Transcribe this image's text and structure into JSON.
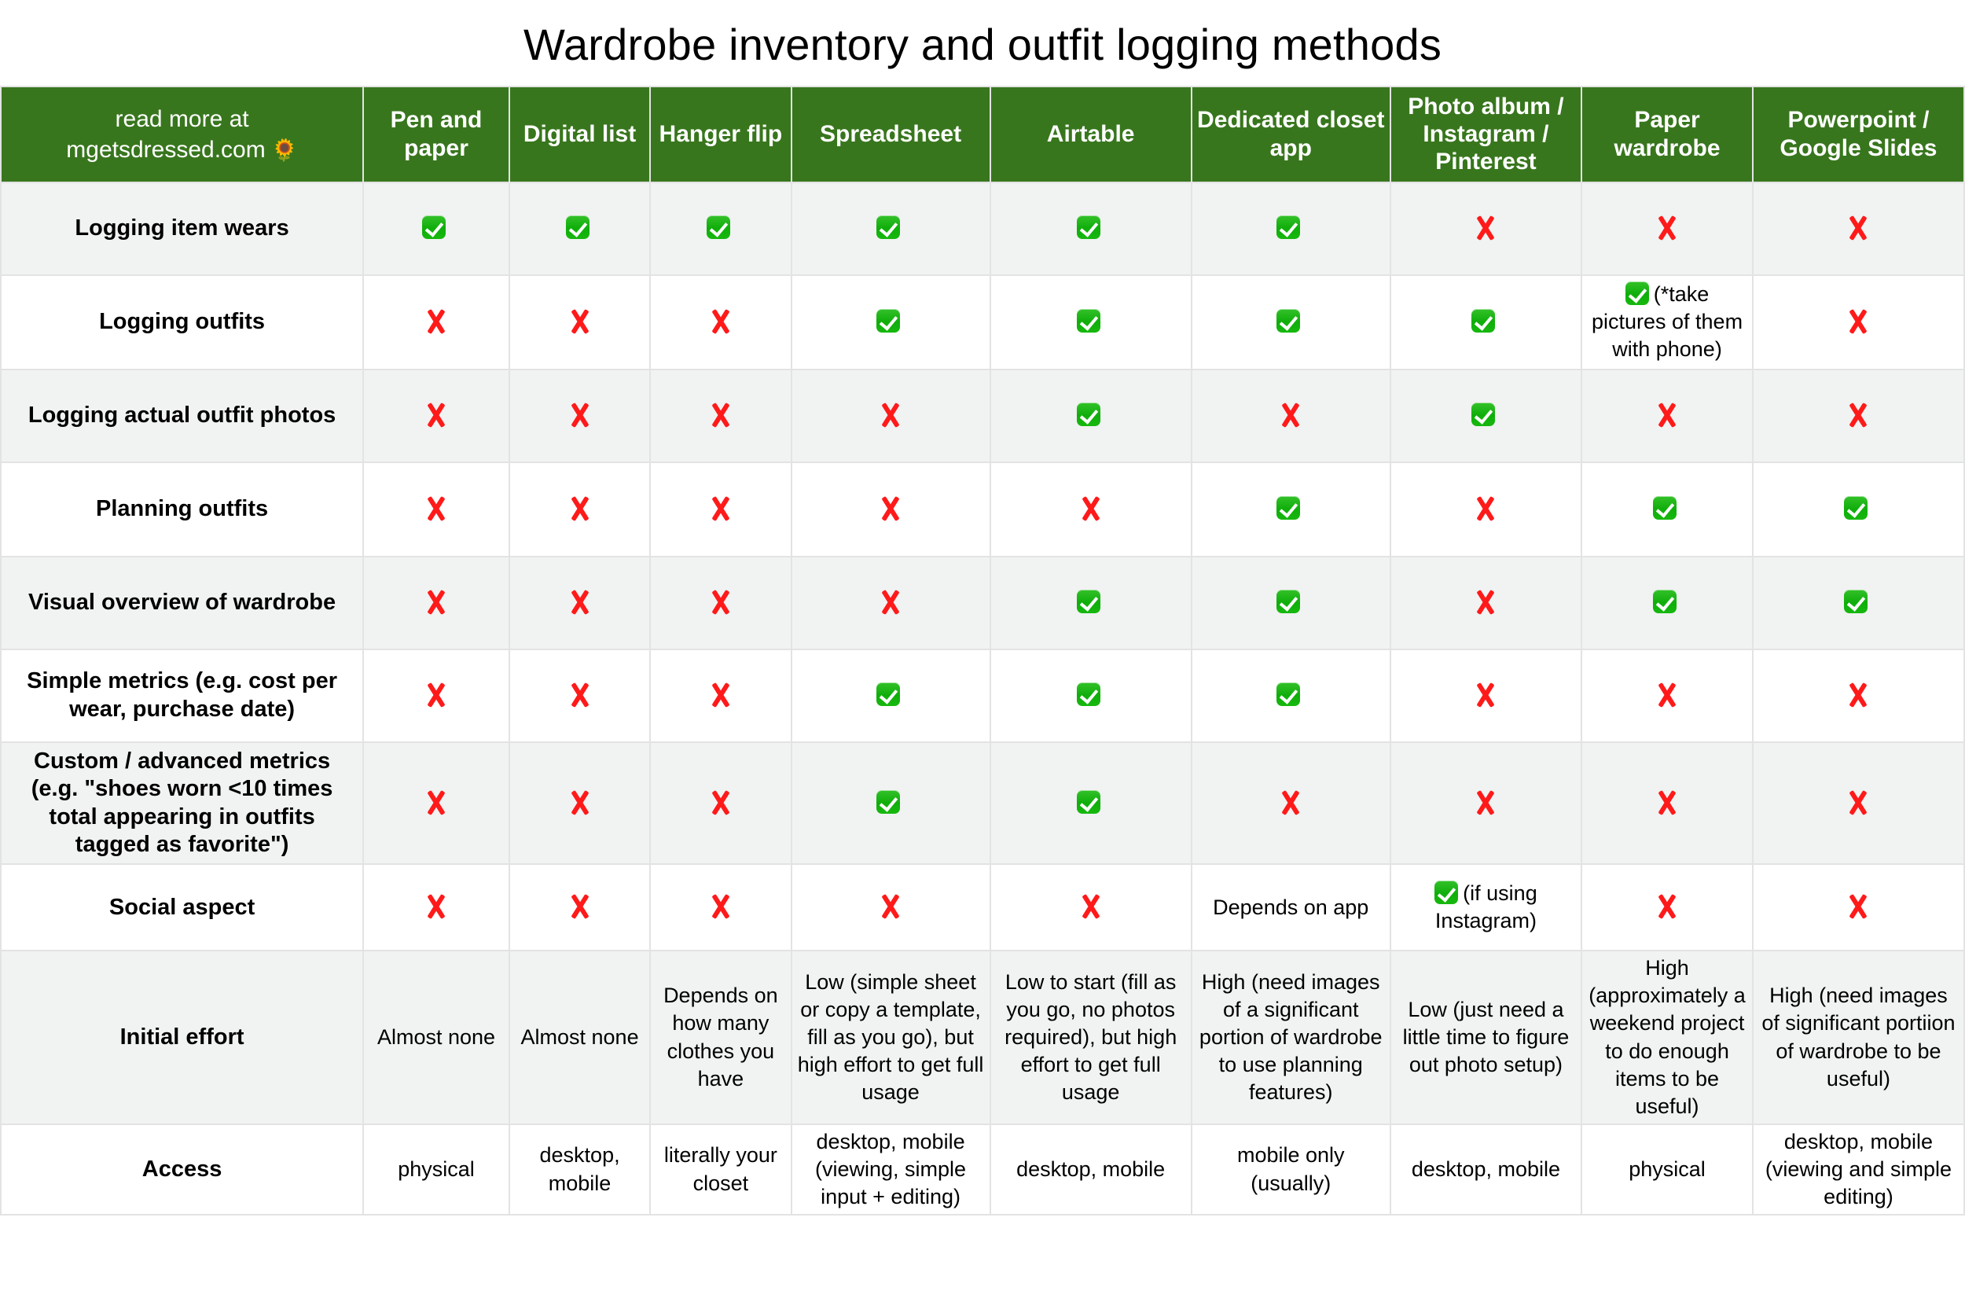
{
  "title": "Wardrobe inventory and outfit logging methods",
  "header": {
    "corner_line1": "read more at",
    "corner_line2": "mgetsdressed.com",
    "corner_icon": "sunflower-icon",
    "columns": [
      "Pen and paper",
      "Digital list",
      "Hanger flip",
      "Spreadsheet",
      "Airtable",
      "Dedicated closet app",
      "Photo album / Instagram / Pinterest",
      "Paper wardrobe",
      "Powerpoint / Google Slides"
    ]
  },
  "colors": {
    "header_green": "#38761d",
    "check_green": "#12b00c",
    "x_red": "#ff1a1a",
    "alt_row": "#f1f2f2"
  },
  "rows": [
    {
      "label": "Logging item wears",
      "cells": [
        {
          "mark": "check"
        },
        {
          "mark": "check"
        },
        {
          "mark": "check"
        },
        {
          "mark": "check"
        },
        {
          "mark": "check"
        },
        {
          "mark": "check"
        },
        {
          "mark": "x"
        },
        {
          "mark": "x"
        },
        {
          "mark": "x"
        }
      ]
    },
    {
      "label": "Logging outfits",
      "cells": [
        {
          "mark": "x"
        },
        {
          "mark": "x"
        },
        {
          "mark": "x"
        },
        {
          "mark": "check"
        },
        {
          "mark": "check"
        },
        {
          "mark": "check"
        },
        {
          "mark": "check"
        },
        {
          "mark": "check",
          "text": "(*take pictures of them with phone)"
        },
        {
          "mark": "x"
        }
      ]
    },
    {
      "label": "Logging actual outfit photos",
      "cells": [
        {
          "mark": "x"
        },
        {
          "mark": "x"
        },
        {
          "mark": "x"
        },
        {
          "mark": "x"
        },
        {
          "mark": "check"
        },
        {
          "mark": "x"
        },
        {
          "mark": "check"
        },
        {
          "mark": "x"
        },
        {
          "mark": "x"
        }
      ]
    },
    {
      "label": "Planning outfits",
      "cells": [
        {
          "mark": "x"
        },
        {
          "mark": "x"
        },
        {
          "mark": "x"
        },
        {
          "mark": "x"
        },
        {
          "mark": "x"
        },
        {
          "mark": "check"
        },
        {
          "mark": "x"
        },
        {
          "mark": "check"
        },
        {
          "mark": "check"
        }
      ]
    },
    {
      "label": "Visual overview of wardrobe",
      "cells": [
        {
          "mark": "x"
        },
        {
          "mark": "x"
        },
        {
          "mark": "x"
        },
        {
          "mark": "x"
        },
        {
          "mark": "check"
        },
        {
          "mark": "check"
        },
        {
          "mark": "x"
        },
        {
          "mark": "check"
        },
        {
          "mark": "check"
        }
      ]
    },
    {
      "label": "Simple metrics (e.g. cost per wear, purchase date)",
      "cells": [
        {
          "mark": "x"
        },
        {
          "mark": "x"
        },
        {
          "mark": "x"
        },
        {
          "mark": "check"
        },
        {
          "mark": "check"
        },
        {
          "mark": "check"
        },
        {
          "mark": "x"
        },
        {
          "mark": "x"
        },
        {
          "mark": "x"
        }
      ]
    },
    {
      "label": "Custom / advanced metrics (e.g. \"shoes worn <10 times total appearing in outfits tagged as favorite\")",
      "cells": [
        {
          "mark": "x"
        },
        {
          "mark": "x"
        },
        {
          "mark": "x"
        },
        {
          "mark": "check"
        },
        {
          "mark": "check"
        },
        {
          "mark": "x"
        },
        {
          "mark": "x"
        },
        {
          "mark": "x"
        },
        {
          "mark": "x"
        }
      ]
    },
    {
      "label": "Social aspect",
      "cells": [
        {
          "mark": "x"
        },
        {
          "mark": "x"
        },
        {
          "mark": "x"
        },
        {
          "mark": "x"
        },
        {
          "mark": "x"
        },
        {
          "mark": "none",
          "text": "Depends on app"
        },
        {
          "mark": "check",
          "text": "(if using Instagram)"
        },
        {
          "mark": "x"
        },
        {
          "mark": "x"
        }
      ]
    },
    {
      "label": "Initial effort",
      "style": "effort",
      "cells": [
        {
          "mark": "none",
          "text": "Almost none"
        },
        {
          "mark": "none",
          "text": "Almost none"
        },
        {
          "mark": "none",
          "text": "Depends on how many clothes you have"
        },
        {
          "mark": "none",
          "text": "Low (simple sheet or copy a template, fill as you go), but high effort to get full usage"
        },
        {
          "mark": "none",
          "text": "Low to start (fill as you go, no photos required), but high effort to get full usage"
        },
        {
          "mark": "none",
          "text": "High (need images of a significant portion of wardrobe to use planning features)"
        },
        {
          "mark": "none",
          "text": "Low (just need a little time to figure out photo setup)"
        },
        {
          "mark": "none",
          "text": "High (approximately a weekend project to do enough items to be useful)"
        },
        {
          "mark": "none",
          "text": "High (need images of significant portiion of wardrobe to be useful)"
        }
      ]
    },
    {
      "label": "Access",
      "style": "access",
      "cells": [
        {
          "mark": "none",
          "text": "physical"
        },
        {
          "mark": "none",
          "text": "desktop, mobile"
        },
        {
          "mark": "none",
          "text": "literally your closet"
        },
        {
          "mark": "none",
          "text": "desktop, mobile (viewing, simple input + editing)"
        },
        {
          "mark": "none",
          "text": "desktop, mobile"
        },
        {
          "mark": "none",
          "text": "mobile only (usually)"
        },
        {
          "mark": "none",
          "text": "desktop, mobile"
        },
        {
          "mark": "none",
          "text": "physical"
        },
        {
          "mark": "none",
          "text": "desktop, mobile (viewing and simple editing)"
        }
      ]
    }
  ]
}
